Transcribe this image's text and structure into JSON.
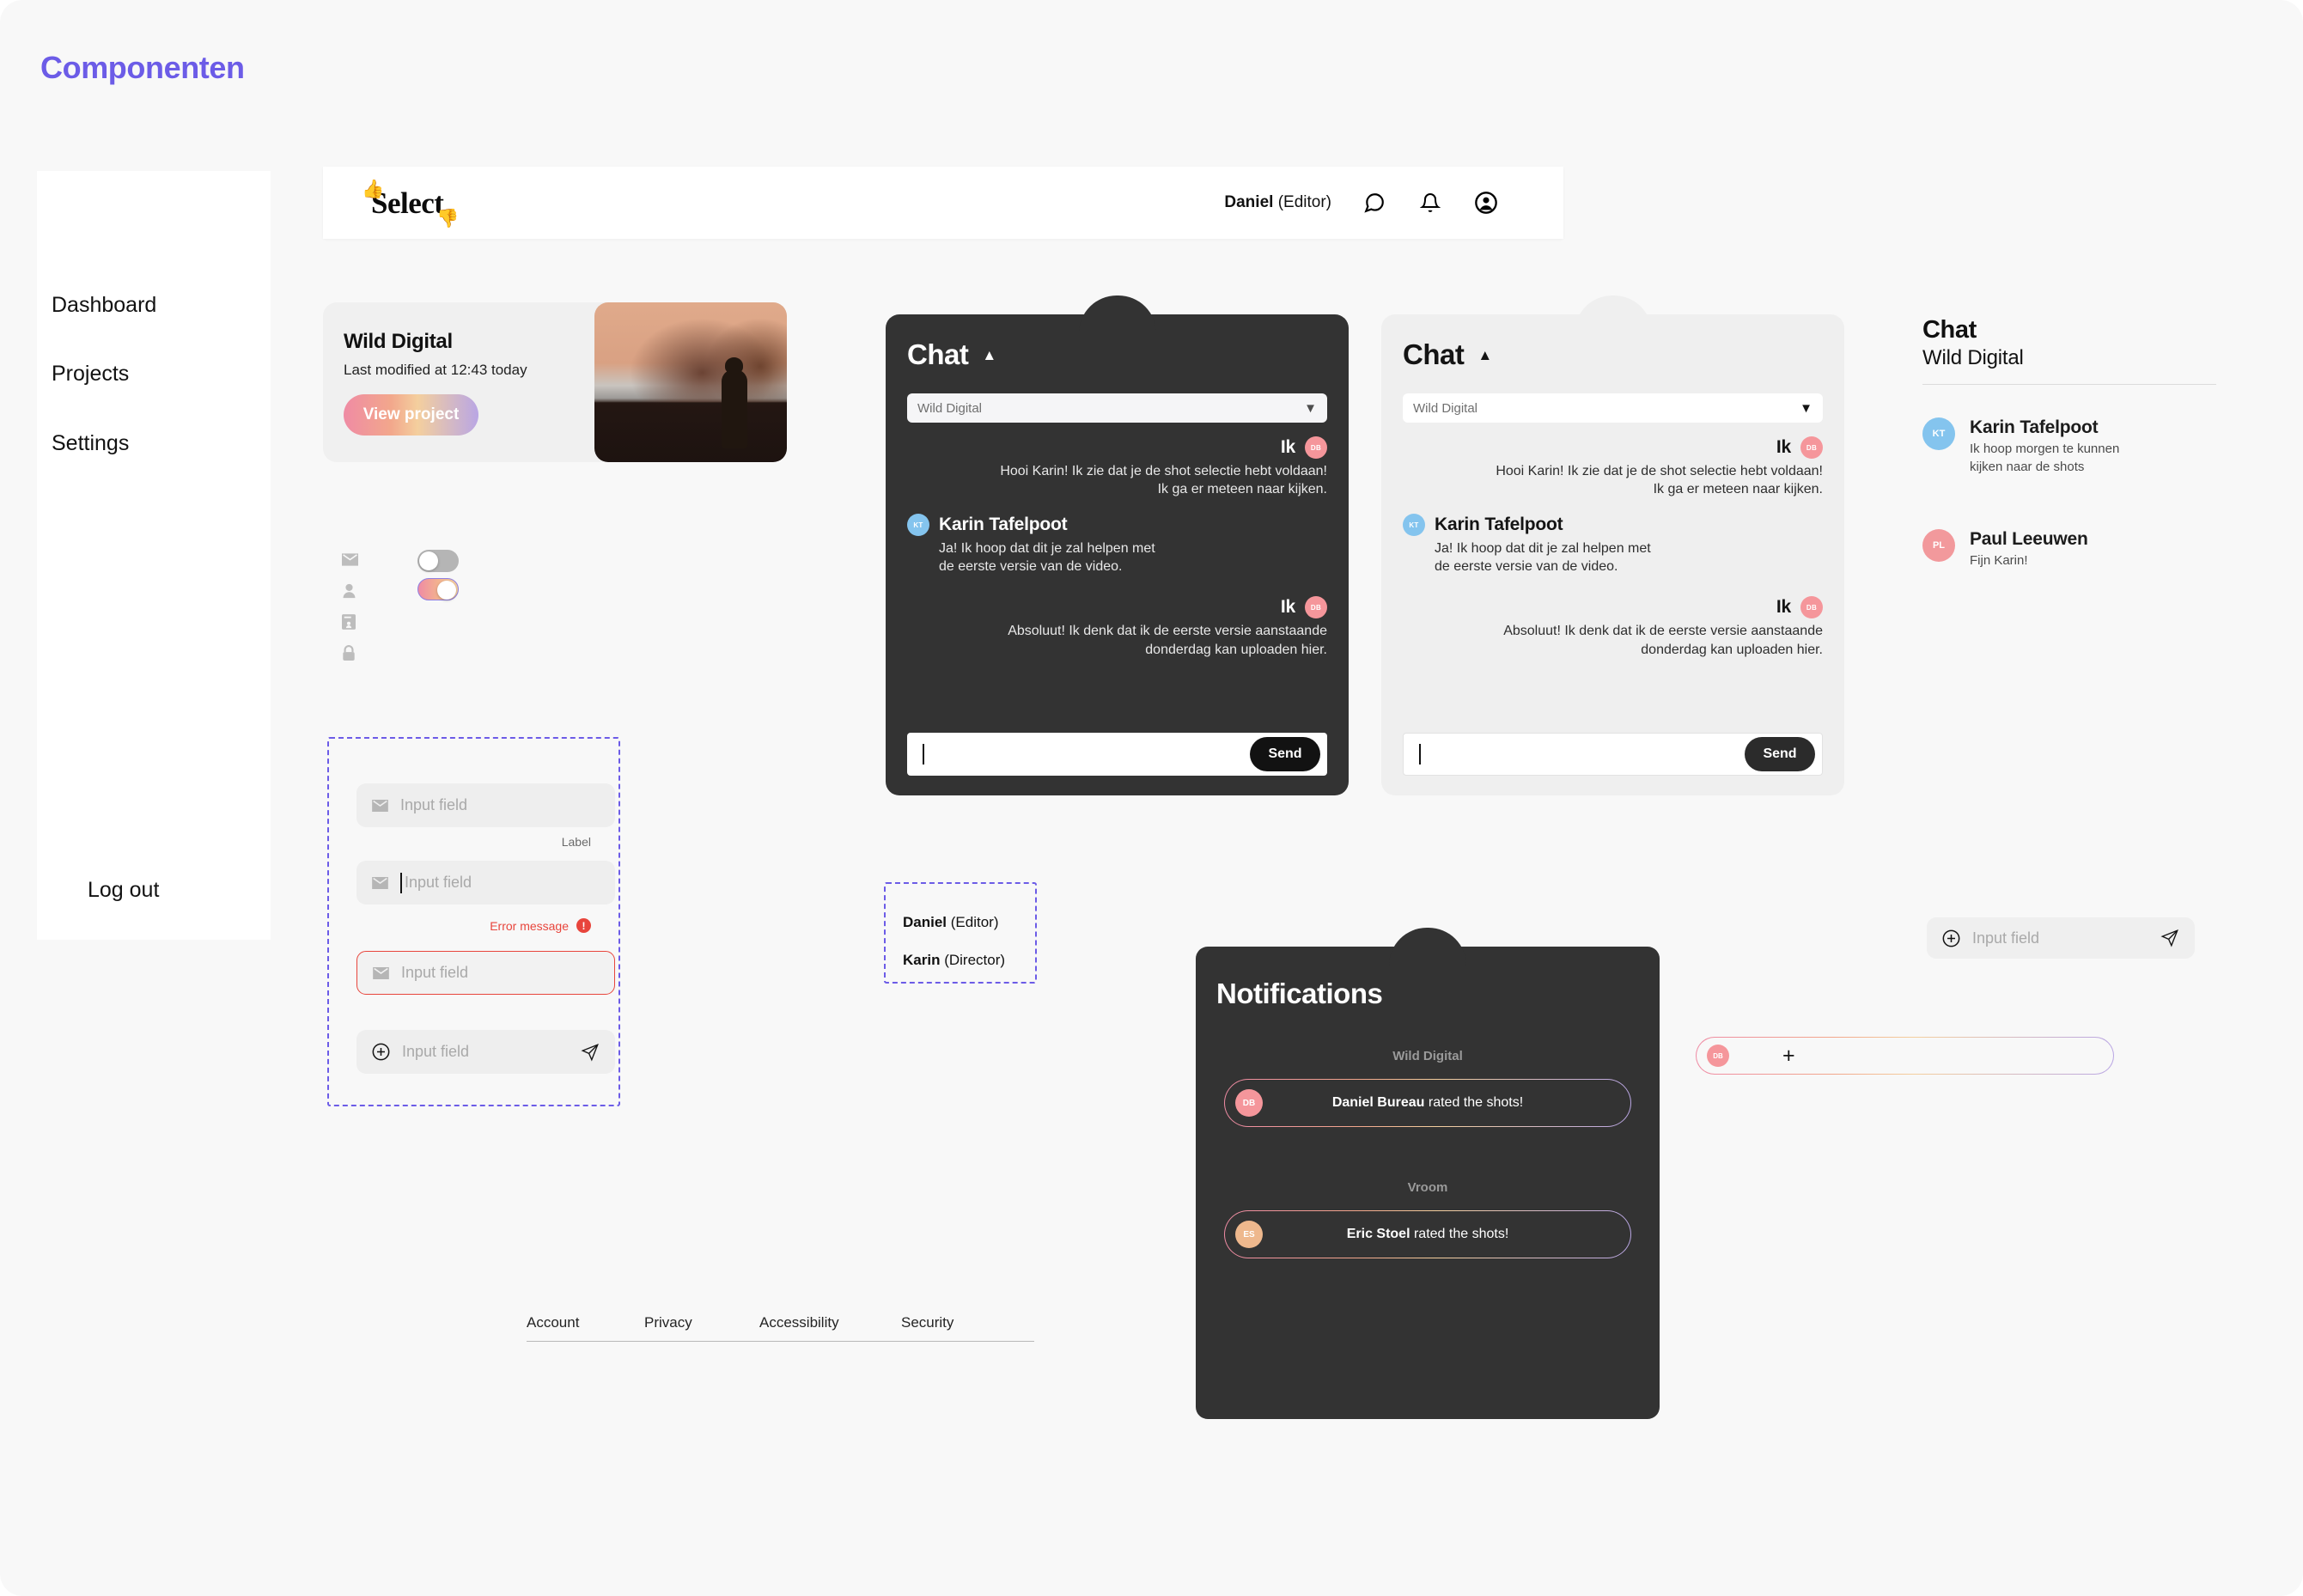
{
  "page": {
    "title": "Componenten",
    "accent": "#6c5ce7",
    "background": "#f8f8f8"
  },
  "sidebar": {
    "items": [
      {
        "label": "Dashboard"
      },
      {
        "label": "Projects"
      },
      {
        "label": "Settings"
      }
    ],
    "logout_label": "Log out"
  },
  "topbar": {
    "brand": "Select",
    "user_name": "Daniel",
    "user_role": "(Editor)",
    "icons": [
      "chat-bubble-icon",
      "bell-icon",
      "account-circle-icon"
    ]
  },
  "project_card": {
    "title": "Wild Digital",
    "subtitle": "Last modified at 12:43 today",
    "button_label": "View project"
  },
  "toggles": {
    "icons": [
      "mail-icon",
      "person-icon",
      "id-card-icon",
      "lock-icon"
    ],
    "off_state": "off",
    "on_state": "on",
    "on_gradient": "#ef8ba4 → #f6d3a3"
  },
  "inputs": {
    "placeholder": "Input field",
    "label_text": "Label",
    "error_text": "Error message",
    "fields": [
      {
        "icon": "mail-icon",
        "state": "default"
      },
      {
        "icon": "mail-icon",
        "state": "focused"
      },
      {
        "icon": "mail-icon",
        "state": "error"
      },
      {
        "icon": "plus-circle-icon",
        "state": "with-send",
        "trailing_icon": "send-icon"
      }
    ]
  },
  "roles_box": {
    "rows": [
      {
        "name": "Daniel",
        "role": "(Editor)"
      },
      {
        "name": "Karin",
        "role": "(Director)"
      }
    ]
  },
  "chat": {
    "title": "Chat",
    "collapse_caret": "▲",
    "select_value": "Wild Digital",
    "select_caret": "▼",
    "send_label": "Send",
    "messages": [
      {
        "who": "Ik",
        "avatar": "DB",
        "avatar_class": "db",
        "side": "me",
        "text": "Hooi Karin! Ik zie dat je de shot selectie hebt voldaan!\nIk ga er meteen naar kijken."
      },
      {
        "who": "Karin Tafelpoot",
        "avatar": "KT",
        "avatar_class": "kt",
        "side": "other",
        "text": "Ja! Ik hoop dat dit je zal helpen met\nde eerste versie van de video."
      },
      {
        "who": "Ik",
        "avatar": "DB",
        "avatar_class": "db",
        "side": "me",
        "text": "Absoluut! Ik denk dat ik de eerste versie aanstaande\ndonderdag kan uploaden hier."
      }
    ]
  },
  "chat_list": {
    "title": "Chat",
    "subtitle": "Wild Digital",
    "rows": [
      {
        "initials": "KT",
        "color": "#84c4ee",
        "name": "Karin Tafelpoot",
        "message": "Ik hoop morgen te kunnen\nkijken naar de shots"
      },
      {
        "initials": "PL",
        "color": "#f2999c",
        "name": "Paul Leeuwen",
        "message": "Fijn Karin!"
      }
    ]
  },
  "notifications": {
    "title": "Notifications",
    "groups": [
      {
        "label": "Wild Digital",
        "initials": "DB",
        "avatar_class": "db",
        "actor": "Daniel Bureau",
        "action": " rated the shots!"
      },
      {
        "label": "Vroom",
        "initials": "ES",
        "avatar_class": "es",
        "actor": "Eric Stoel",
        "action": " rated the shots!"
      }
    ]
  },
  "footer": {
    "links": [
      "Account",
      "Privacy",
      "Accessibility",
      "Security"
    ]
  },
  "bottom_right": {
    "input_placeholder": "Input field",
    "leading_icon": "plus-circle-icon",
    "trailing_icon": "send-icon",
    "add_row": {
      "initials": "DB",
      "plus": "+"
    }
  }
}
